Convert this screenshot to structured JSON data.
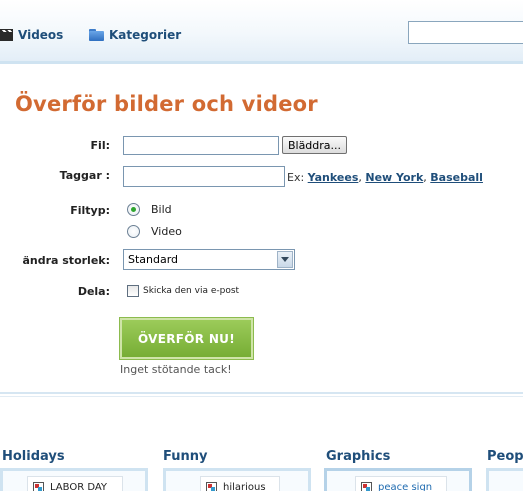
{
  "nav": {
    "videos_label": "Videos",
    "kategorier_label": "Kategorier",
    "search_value": ""
  },
  "form": {
    "title": "Överför bilder och videor",
    "fil_label": "Fil:",
    "browse_label": "Bläddra...",
    "taggar_label": "Taggar :",
    "example_prefix": "Ex:",
    "example_tags": [
      "Yankees",
      "New York",
      "Baseball"
    ],
    "filtyp_label": "Filtyp:",
    "filtyp_options": [
      "Bild",
      "Video"
    ],
    "filtyp_selected": "Bild",
    "andra_label": "ändra storlek:",
    "size_selected": "Standard",
    "dela_label": "Dela:",
    "share_checkbox_label": "Skicka den via e-post",
    "share_checked": false,
    "upload_button": "ÖVERFÖR NU!",
    "upload_note": "Inget stötande tack!"
  },
  "categories": [
    {
      "title": "Holidays",
      "item": "LABOR DAY"
    },
    {
      "title": "Funny",
      "item": "hilarious"
    },
    {
      "title": "Graphics",
      "item": "peace sign"
    },
    {
      "title": "Peop",
      "item": ""
    }
  ],
  "colors": {
    "title_orange": "#d26a32",
    "link_blue": "#1f4e7a",
    "button_green": "#77ad35"
  }
}
